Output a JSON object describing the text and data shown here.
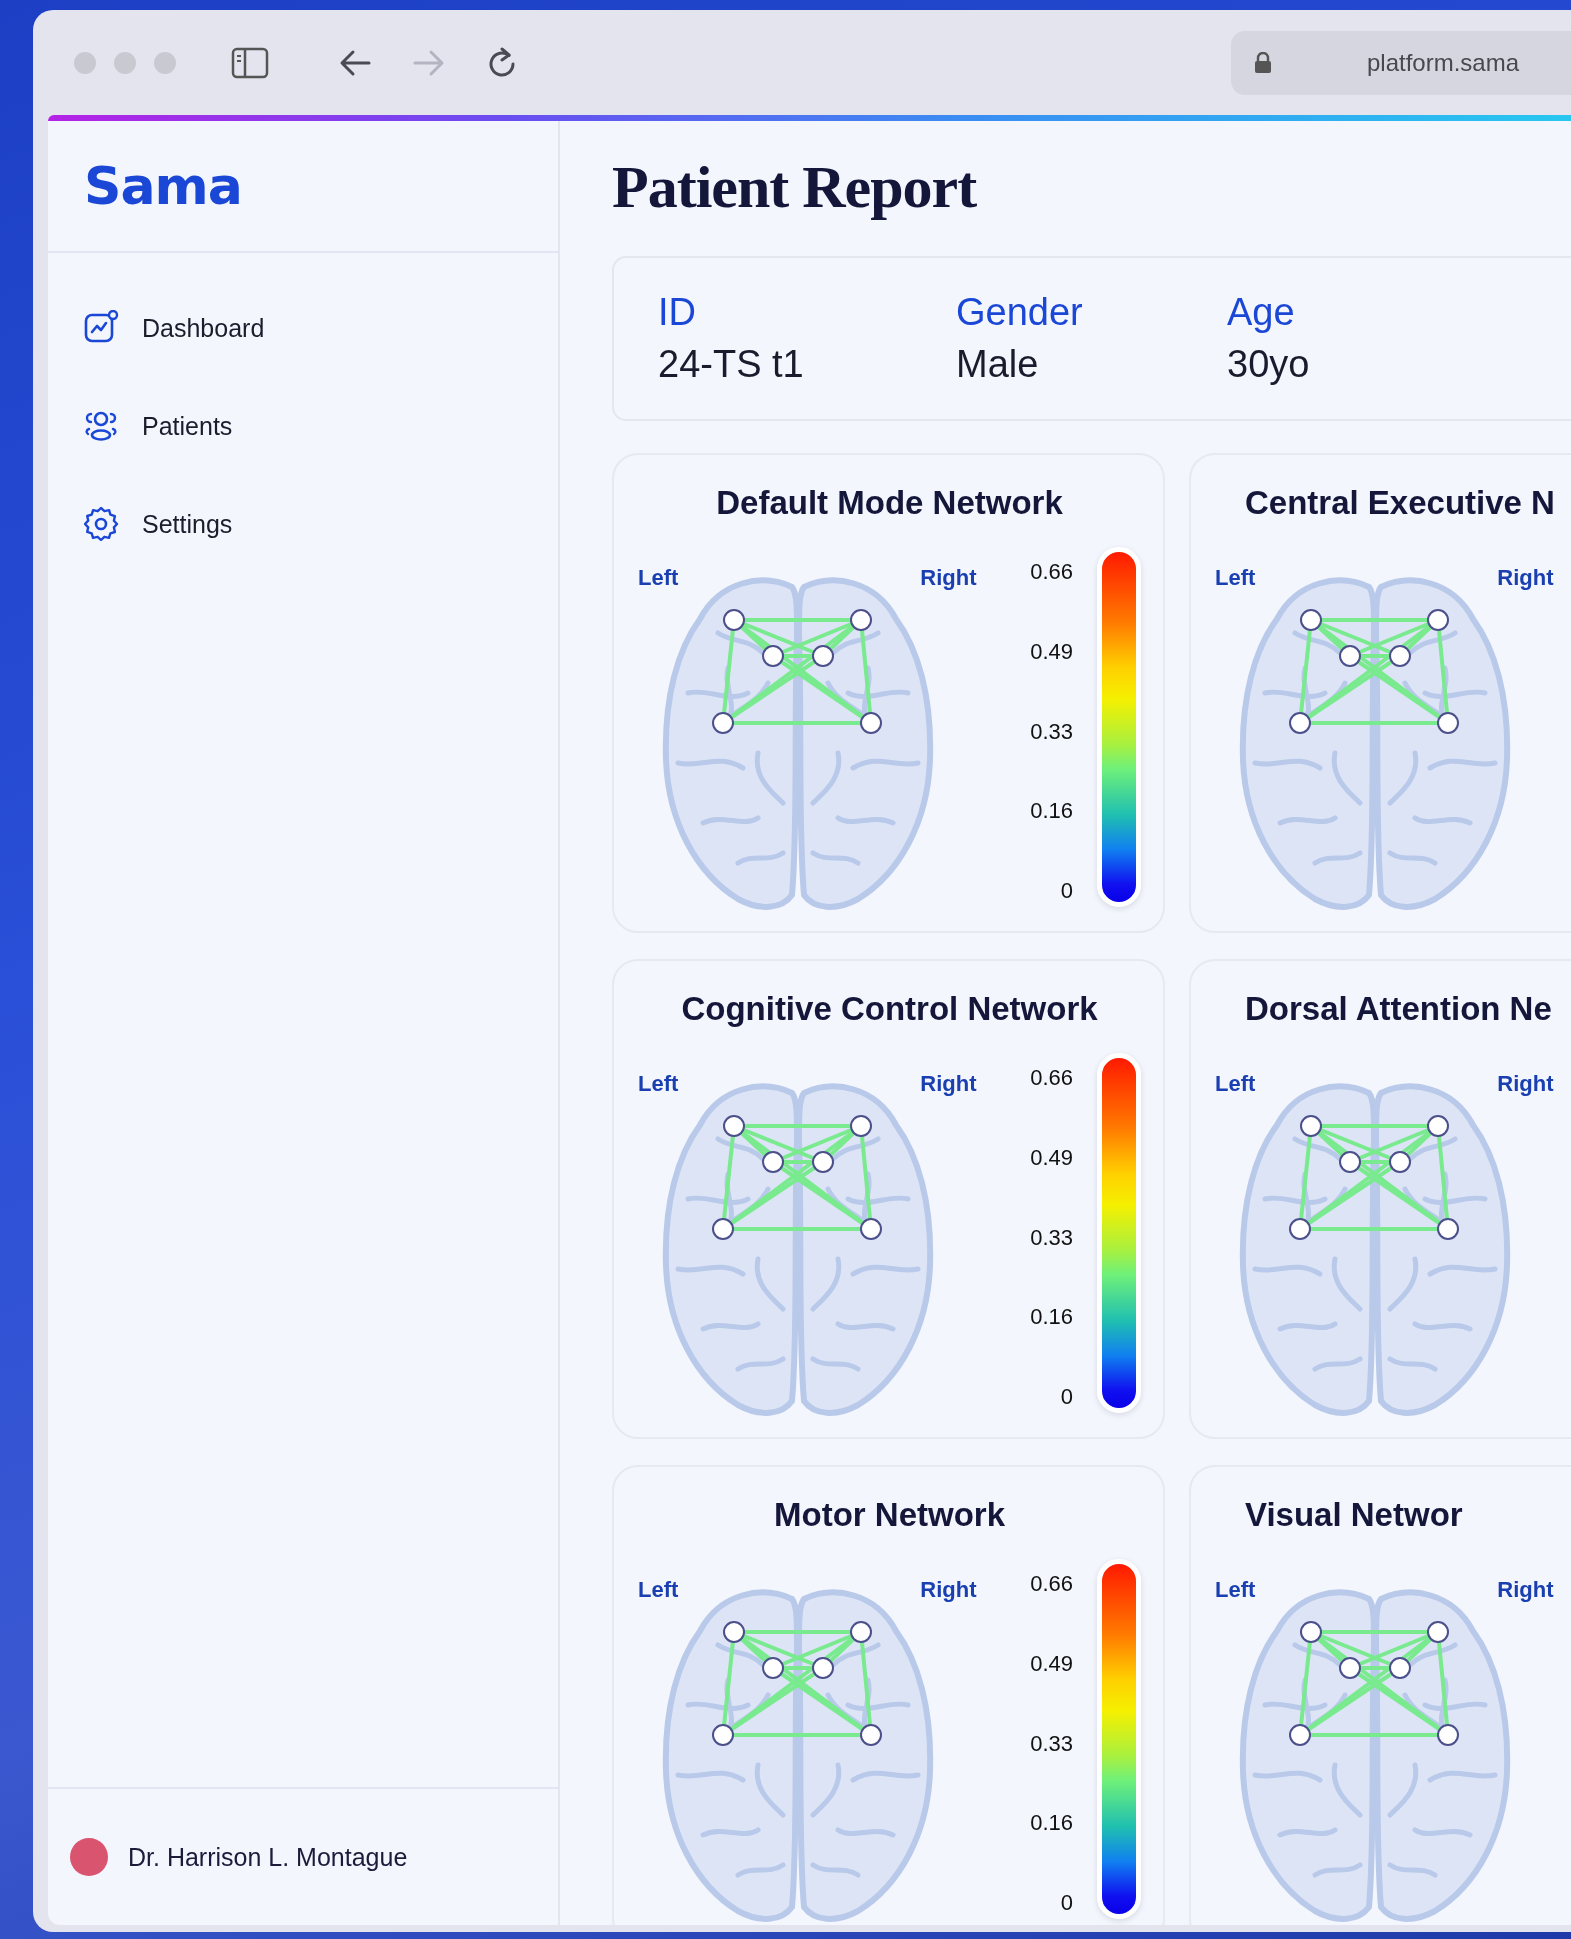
{
  "browser": {
    "nav_buttons": [
      {
        "kind": "back",
        "disabled": false
      },
      {
        "kind": "forward",
        "disabled": true
      },
      {
        "kind": "reload",
        "disabled": false
      }
    ],
    "url": "platform.sama"
  },
  "sidebar": {
    "logo": "Sama",
    "items": [
      {
        "label": "Dashboard",
        "kind": "dashboard",
        "selected": false
      },
      {
        "label": "Patients",
        "kind": "patients",
        "selected": false
      },
      {
        "label": "Settings",
        "kind": "settings",
        "selected": false
      }
    ],
    "user": {
      "name": "Dr. Harrison L. Montague"
    }
  },
  "page": {
    "title": "Patient Report"
  },
  "patient_info": [
    {
      "label": "ID",
      "value": "24-TS t1"
    },
    {
      "label": "Gender",
      "value": "Male"
    },
    {
      "label": "Age",
      "value": "30yo"
    }
  ],
  "networks": [
    {
      "title": "Default Mode Network",
      "left_label": "Left",
      "right_label": "Right",
      "scale_labels": [
        "0.66",
        "0.49",
        "0.33",
        "0.16",
        "0"
      ]
    },
    {
      "title": "Central Executive N",
      "left_label": "Left",
      "right_label": "Right"
    },
    {
      "title": "Cognitive Control Network",
      "left_label": "Left",
      "right_label": "Right",
      "scale_labels": [
        "0.66",
        "0.49",
        "0.33",
        "0.16",
        "0"
      ]
    },
    {
      "title": "Dorsal Attention Ne",
      "left_label": "Left",
      "right_label": "Right"
    },
    {
      "title": "Motor Network",
      "left_label": "Left",
      "right_label": "Right",
      "scale_labels": [
        "0.66",
        "0.49",
        "0.33",
        "0.16",
        "0"
      ]
    },
    {
      "title": "Visual Networ",
      "left_label": "Left",
      "right_label": "Right"
    }
  ]
}
